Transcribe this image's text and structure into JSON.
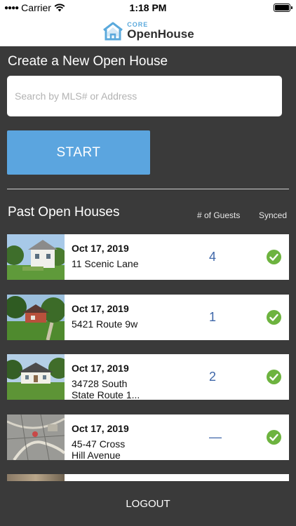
{
  "status_bar": {
    "carrier": "Carrier",
    "time": "1:18 PM",
    "battery_level": 1.0
  },
  "header": {
    "logo_core": "CORE",
    "logo_name": "OpenHouse",
    "brand_color": "#5aa9dc"
  },
  "create": {
    "title": "Create a New Open House",
    "search_placeholder": "Search by MLS# or Address",
    "search_value": "",
    "start_label": "START",
    "start_color": "#5ba5df"
  },
  "past": {
    "title": "Past Open Houses",
    "col_guests": "# of Guests",
    "col_synced": "Synced",
    "items": [
      {
        "date": "Oct 17, 2019",
        "address_line1": "11 Scenic Lane",
        "address_line2": "",
        "guests": "4",
        "synced": true,
        "photo": "house-photo-1"
      },
      {
        "date": "Oct 17, 2019",
        "address_line1": "5421 Route 9w",
        "address_line2": "",
        "guests": "1",
        "synced": true,
        "photo": "house-photo-2"
      },
      {
        "date": "Oct 17, 2019",
        "address_line1": "34728 South",
        "address_line2": "State Route 1...",
        "guests": "2",
        "synced": true,
        "photo": "house-photo-3"
      },
      {
        "date": "Oct 17, 2019",
        "address_line1": "45-47 Cross",
        "address_line2": "Hill Avenue",
        "guests": "—",
        "synced": true,
        "photo": "plat-map-photo"
      }
    ],
    "synced_color": "#6db33f",
    "guests_color": "#3f67a9"
  },
  "footer": {
    "logout_label": "LOGOUT"
  }
}
